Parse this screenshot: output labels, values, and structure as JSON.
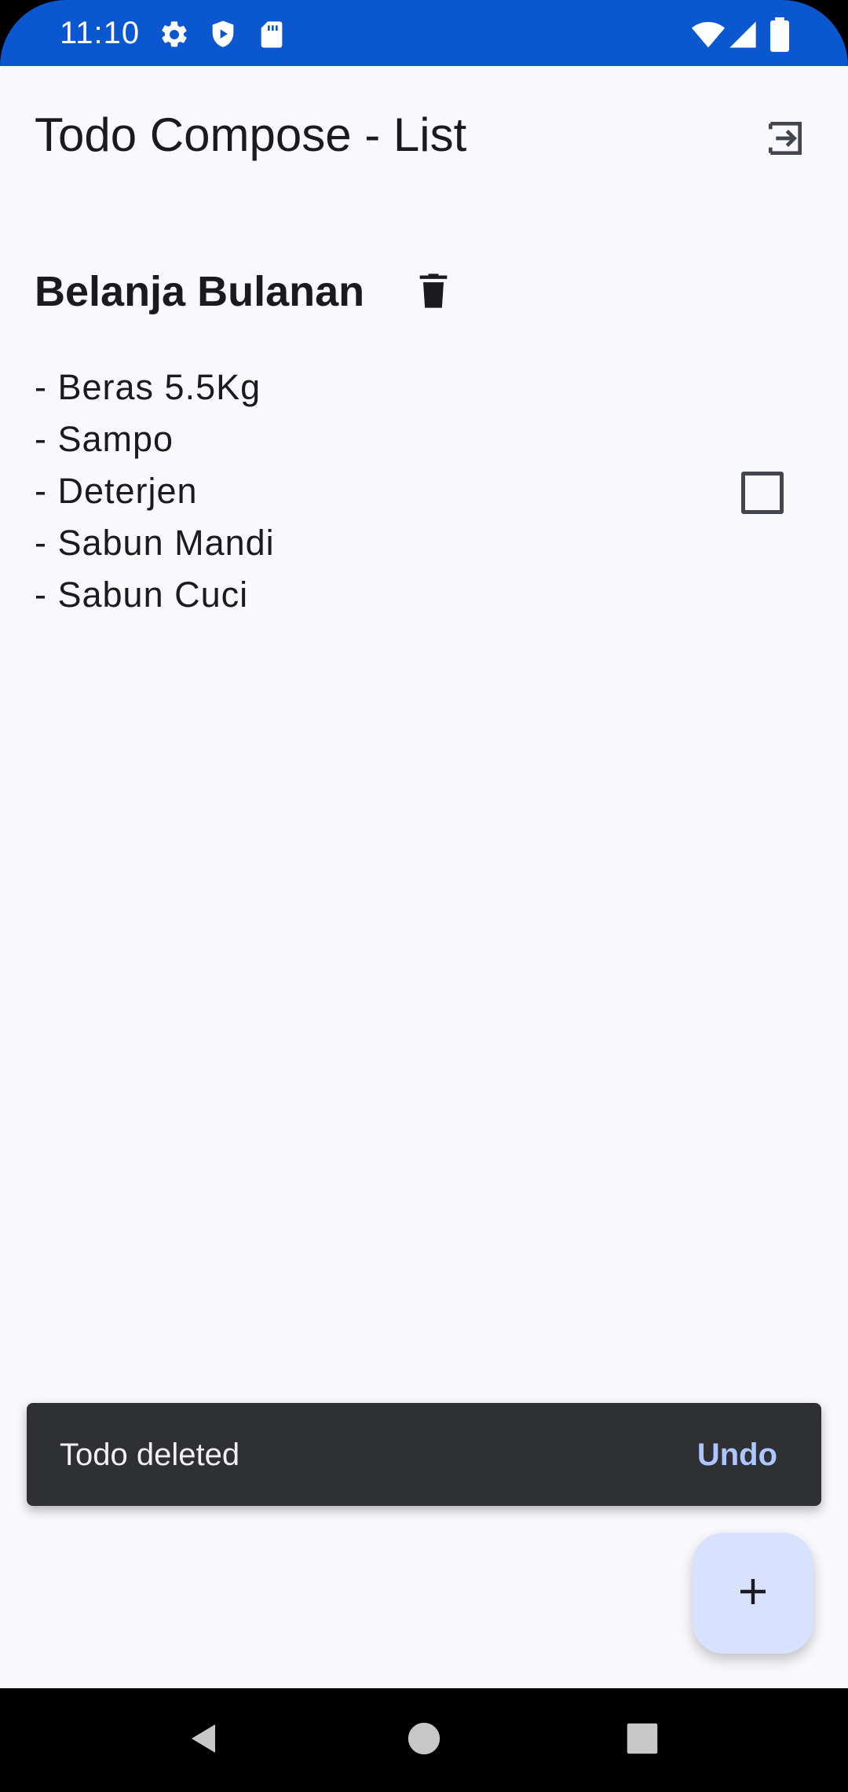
{
  "status_bar": {
    "time": "11:10",
    "left_icons": [
      "settings-icon",
      "shield-icon",
      "sd-card-icon"
    ],
    "right_icons": [
      "wifi-icon",
      "cell-signal-icon",
      "battery-icon"
    ],
    "background": "#0b57d0"
  },
  "top_app_bar": {
    "title": "Todo Compose - List",
    "action_icon": "logout-icon"
  },
  "todo": {
    "title": "Belanja Bulanan",
    "delete_icon": "trash-icon",
    "items": [
      "- Beras 5.5Kg",
      "- Sampo",
      "- Deterjen",
      "- Sabun Mandi",
      "- Sabun Cuci"
    ],
    "checked": false
  },
  "snackbar": {
    "message": "Todo deleted",
    "action": "Undo",
    "background": "#2f3033",
    "action_color": "#adc6ff"
  },
  "fab": {
    "icon": "plus-icon",
    "background": "#d8e2ff"
  },
  "navigation_bar": {
    "buttons": [
      "back-icon",
      "home-icon",
      "recents-icon"
    ]
  }
}
